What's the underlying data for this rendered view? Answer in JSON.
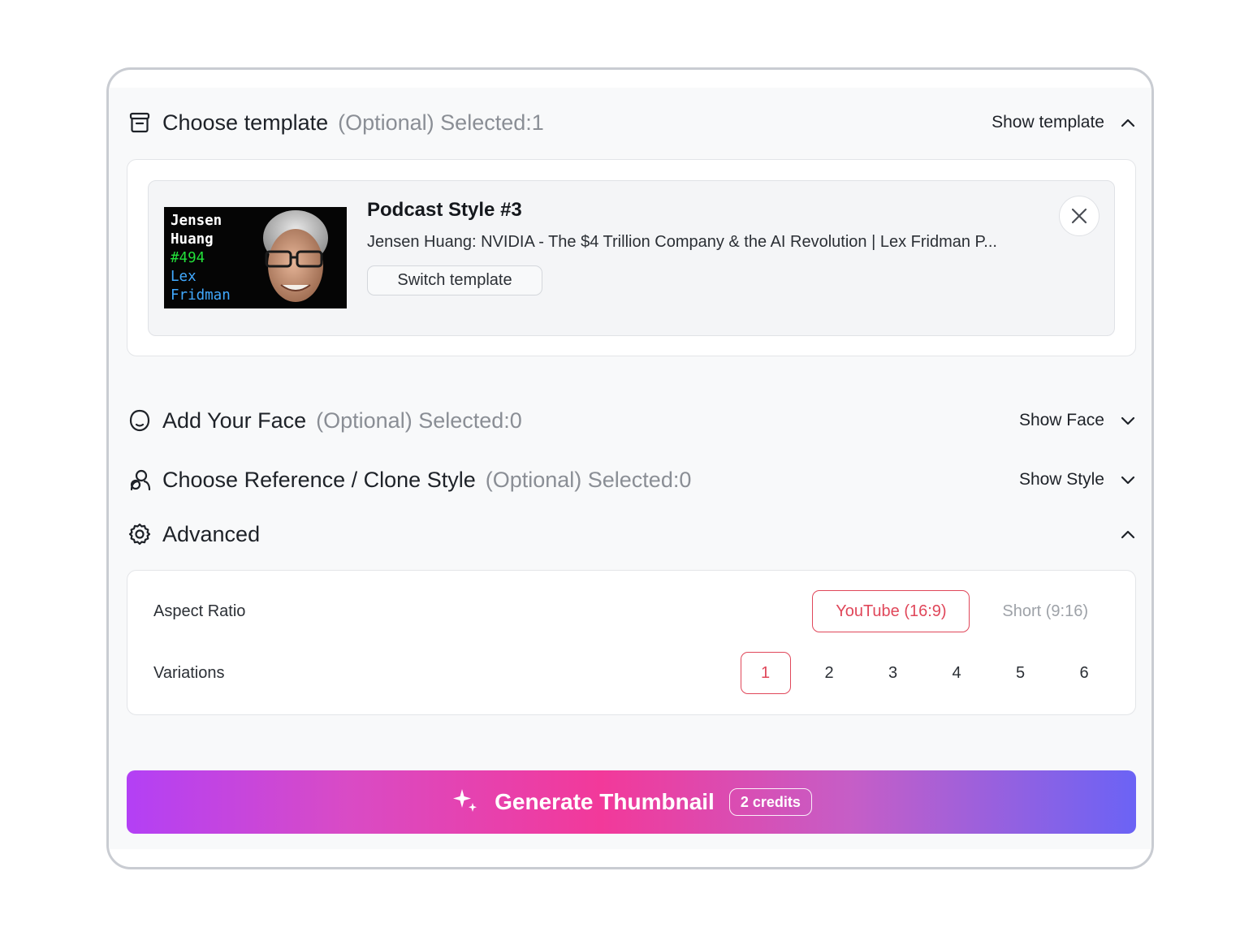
{
  "template_section": {
    "title": "Choose template",
    "meta": "(Optional) Selected:1",
    "toggle_label": "Show template",
    "template": {
      "thumbnail_text": {
        "line1": "Jensen",
        "line2": "Huang",
        "line3": "#494",
        "line4": "Lex",
        "line5": "Fridman"
      },
      "name": "Podcast Style #3",
      "description": "Jensen Huang: NVIDIA - The $4 Trillion Company & the AI Revolution | Lex Fridman P...",
      "switch_label": "Switch template"
    }
  },
  "face_section": {
    "title": "Add Your Face",
    "meta": "(Optional) Selected:0",
    "toggle_label": "Show Face"
  },
  "style_section": {
    "title": "Choose Reference / Clone Style",
    "meta": "(Optional) Selected:0",
    "toggle_label": "Show Style"
  },
  "advanced_section": {
    "title": "Advanced",
    "aspect_ratio": {
      "label": "Aspect Ratio",
      "options": [
        "YouTube (16:9)",
        "Short (9:16)"
      ],
      "selected": "YouTube (16:9)"
    },
    "variations": {
      "label": "Variations",
      "options": [
        "1",
        "2",
        "3",
        "4",
        "5",
        "6"
      ],
      "selected": "1"
    }
  },
  "generate": {
    "label": "Generate Thumbnail",
    "credits": "2 credits"
  },
  "colors": {
    "accent": "#e0475a",
    "gradient": [
      "#b340f5",
      "#f2399a",
      "#6b63f5"
    ],
    "thumb_green": "#22e03a",
    "thumb_blue": "#41a9ff"
  }
}
